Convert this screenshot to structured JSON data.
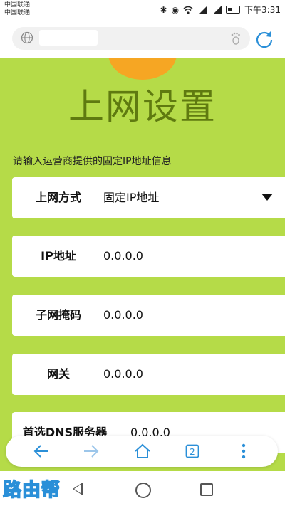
{
  "status_bar": {
    "carrier_1": "中国联通",
    "carrier_2": "中国联通",
    "time": "下午3:31",
    "icons": [
      "bluetooth-icon",
      "eye-icon",
      "wifi-icon",
      "signal-4g-icon",
      "signal-2g-icon",
      "battery-icon"
    ]
  },
  "browser": {
    "url_text": "",
    "icons": [
      "globe-icon",
      "footprint-icon",
      "reload-icon"
    ]
  },
  "page": {
    "title": "上网设置",
    "hint": "请输入运营商提供的固定IP地址信息",
    "fields": [
      {
        "label": "上网方式",
        "value": "固定IP地址"
      },
      {
        "label": "IP地址",
        "value": "0.0.0.0"
      },
      {
        "label": "子网掩码",
        "value": "0.0.0.0"
      },
      {
        "label": "网关",
        "value": "0.0.0.0"
      },
      {
        "label": "首选DNS服务器",
        "value": "0.0.0.0"
      }
    ]
  },
  "toolbar": {
    "tab_count": "2",
    "icons": [
      "back-arrow-icon",
      "forward-arrow-icon",
      "home-icon",
      "tabs-icon",
      "more-icon"
    ]
  },
  "watermark": "路由帮",
  "colors": {
    "page_bg": "#b5db48",
    "title": "#5f7a10",
    "logo": "#f6a623",
    "accent_blue": "#2a8fd8"
  }
}
